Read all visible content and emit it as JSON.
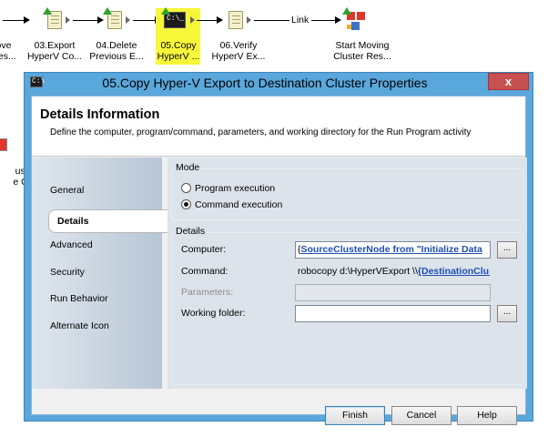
{
  "workflow": {
    "activities": [
      {
        "label": "ove\nRes..."
      },
      {
        "label": "03.Export\nHyperV Co..."
      },
      {
        "label": "04.Delete\nPrevious E..."
      },
      {
        "label": "05.Copy\nHyperV ..."
      },
      {
        "label": "06.Verify\nHyperV Ex..."
      },
      {
        "label": "Start Moving\nCluster Res..."
      },
      {
        "label": "uster\ne G..."
      }
    ],
    "link_label": "Link",
    "selected_highlight": "#f7f73a"
  },
  "dialog": {
    "title": "05.Copy Hyper-V Export to Destination Cluster Properties",
    "close_glyph": "x",
    "header": {
      "title": "Details Information",
      "description": "Define the computer, program/command, parameters, and working directory for the Run Program activity"
    },
    "nav": {
      "items": [
        {
          "label": "General"
        },
        {
          "label": "Details"
        },
        {
          "label": "Advanced"
        },
        {
          "label": "Security"
        },
        {
          "label": "Run Behavior"
        },
        {
          "label": "Alternate Icon"
        }
      ],
      "selected": "Details"
    },
    "mode": {
      "label": "Mode",
      "options": [
        {
          "label": "Program execution",
          "checked": false
        },
        {
          "label": "Command execution",
          "checked": true
        }
      ]
    },
    "details": {
      "label": "Details",
      "computer": {
        "label": "Computer:",
        "prefix": "{",
        "link": "SourceClusterNode from \"Initialize Data"
      },
      "command": {
        "label": "Command:",
        "text": "robocopy d:\\HyperVExport \\\\",
        "link": "{DestinationClus"
      },
      "parameters": {
        "label": "Parameters:",
        "value": ""
      },
      "working_folder": {
        "label": "Working folder:",
        "value": ""
      },
      "browse_label": "..."
    },
    "buttons": {
      "finish": "Finish",
      "cancel": "Cancel",
      "help": "Help"
    }
  }
}
